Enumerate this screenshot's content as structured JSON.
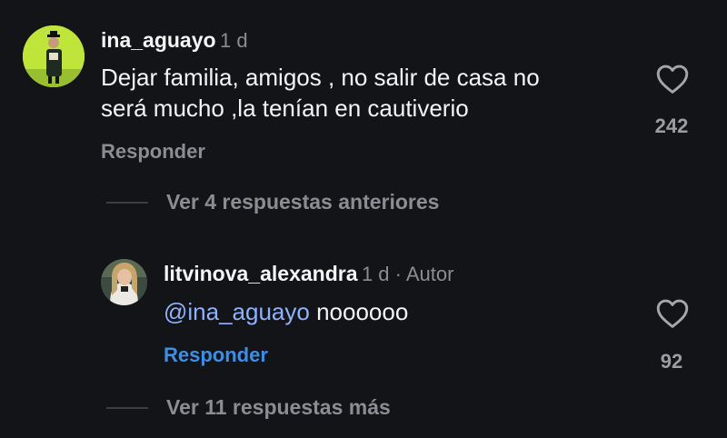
{
  "comments": [
    {
      "username": "ina_aguayo",
      "meta": "1 d",
      "text_lines": [
        "Dejar familia, amigos , no salir de casa no",
        "será mucho ,la tenían en cautiverio"
      ],
      "reply_label": "Responder",
      "like_count": "242",
      "avatar_icon": "graduate-avatar"
    },
    {
      "username": "litvinova_alexandra",
      "meta": "1 d · Autor",
      "mention": "@ina_aguayo",
      "text": "noooooo",
      "reply_label": "Responder",
      "like_count": "92",
      "avatar_icon": "woman-avatar"
    }
  ],
  "thread_links": {
    "previous_replies": "Ver 4 respuestas anteriores",
    "more_replies": "Ver 11 respuestas más"
  },
  "icons": {
    "like": "heart-outline-icon"
  },
  "colors": {
    "background": "#121418",
    "primary_text": "#f4f4f4",
    "secondary_text": "#8a8d92",
    "mention": "#8fb1ff",
    "reply_link_active": "#3d8fe6"
  }
}
